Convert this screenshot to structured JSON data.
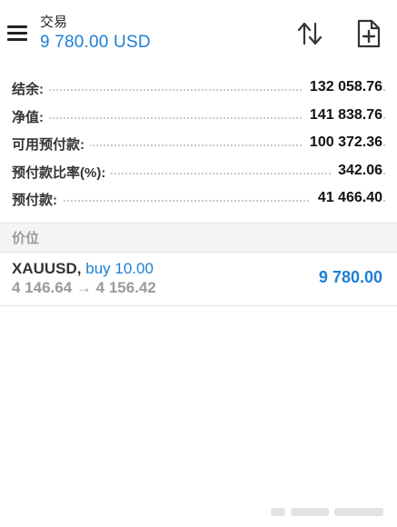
{
  "header": {
    "title": "交易",
    "balance": "9 780.00 USD"
  },
  "summary": {
    "rows": [
      {
        "label": "结余:",
        "value": "132 058.76"
      },
      {
        "label": "净值:",
        "value": "141 838.76"
      },
      {
        "label": "可用预付款:",
        "value": "100 372.36"
      },
      {
        "label": "预付款比率(%):",
        "value": "342.06"
      },
      {
        "label": "预付款:",
        "value": "41 466.40"
      }
    ]
  },
  "section": {
    "title": "价位"
  },
  "positions": [
    {
      "symbol": "XAUUSD,",
      "type": "buy 10.00",
      "open_price": "4 146.64",
      "arrow": "→",
      "current_price": "4 156.42",
      "profit": "9 780.00"
    }
  ],
  "colors": {
    "accent": "#1e7fd6",
    "muted": "#9a9a9a"
  }
}
